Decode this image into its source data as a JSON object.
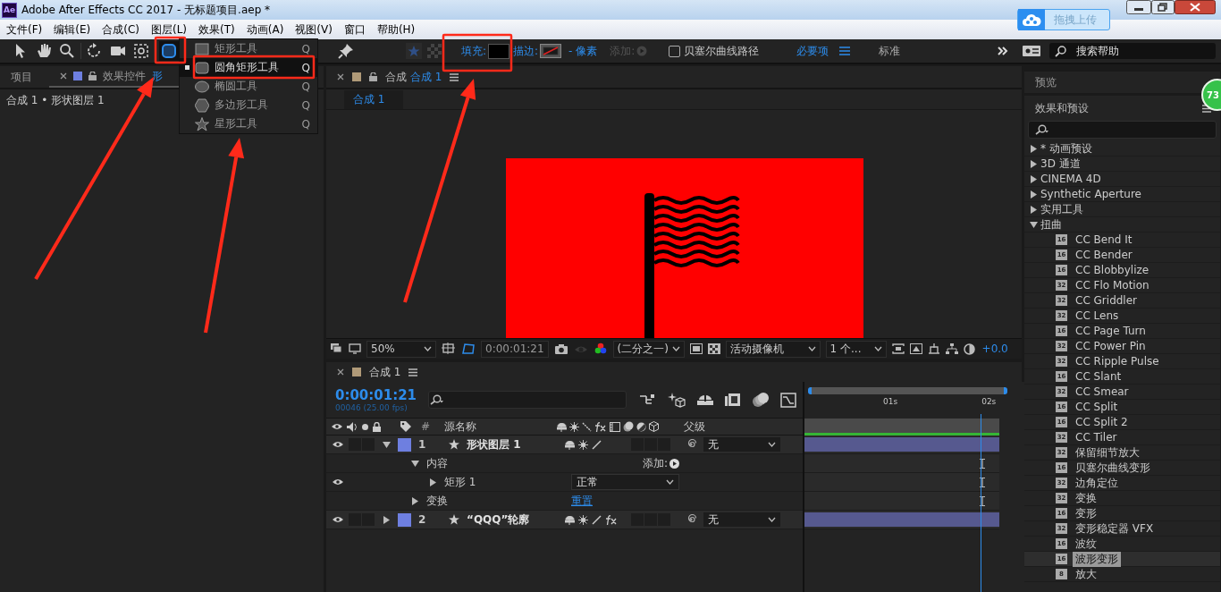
{
  "window": {
    "title": "Adobe After Effects CC 2017 - 无标题项目.aep *",
    "app_icon": "Ae"
  },
  "upload_button": {
    "label": "拖拽上传"
  },
  "badge": {
    "count": "73"
  },
  "menu": [
    "文件(F)",
    "编辑(E)",
    "合成(C)",
    "图层(L)",
    "效果(T)",
    "动画(A)",
    "视图(V)",
    "窗口",
    "帮助(H)"
  ],
  "toolbar": {
    "tools": [
      {
        "kind": "select",
        "selected": false
      },
      {
        "kind": "hand",
        "selected": false
      },
      {
        "kind": "zoom",
        "selected": false
      },
      {
        "kind": "rotate",
        "selected": false
      },
      {
        "kind": "camera",
        "selected": false
      },
      {
        "kind": "pan",
        "selected": false
      },
      {
        "kind": "shape",
        "selected": true
      },
      {
        "kind": "pin",
        "selected": false
      }
    ],
    "fill_label": "填充:",
    "stroke_label": "描边:",
    "stroke_width": "- 像素",
    "add_label": "添加:",
    "bezier": {
      "label": "贝塞尔曲线路径",
      "checked": false
    },
    "workspaces": [
      {
        "label": "必要项",
        "selected": true
      },
      {
        "label": "标准",
        "selected": false
      }
    ],
    "search": {
      "placeholder": "搜索帮助"
    }
  },
  "shape_menu": {
    "items": [
      {
        "kind": "rect",
        "label": "矩形工具",
        "shortcut": "Q",
        "selected": false
      },
      {
        "kind": "rounded",
        "label": "圆角矩形工具",
        "shortcut": "Q",
        "selected": true
      },
      {
        "kind": "ellipse",
        "label": "椭圆工具",
        "shortcut": "Q",
        "selected": false
      },
      {
        "kind": "polygon",
        "label": "多边形工具",
        "shortcut": "Q",
        "selected": false
      },
      {
        "kind": "star",
        "label": "星形工具",
        "shortcut": "Q",
        "selected": false
      }
    ]
  },
  "left_panel": {
    "tabs": [
      {
        "label": "项目",
        "selected": false
      },
      {
        "label": "效果控件",
        "target": "形",
        "selected": true
      }
    ],
    "breadcrumb": "合成 1 • 形状图层 1"
  },
  "viewer": {
    "tab": {
      "label": "合成",
      "target": "合成 1"
    },
    "breadcrumb": "合成 1",
    "zoom": "50%",
    "time": "0:00:01:21",
    "resolution": "(二分之一)",
    "camera": "活动摄像机",
    "views": "1 个...",
    "exposure": "+0.0"
  },
  "timeline": {
    "tab": "合成 1",
    "timecode": "0:00:01:21",
    "frame_info": "00046 (25.00 fps)",
    "columns": [
      "#",
      "源名称",
      "父级"
    ],
    "ruler": [
      "01s",
      "02s"
    ],
    "layers": [
      {
        "kind": "layer",
        "number": "1",
        "name": "形状图层 1",
        "expanded": true,
        "visible": true,
        "fx": false,
        "parent": "无",
        "children": [
          {
            "kind": "group",
            "name": "内容",
            "expanded": true,
            "action": "添加:",
            "children": [
              {
                "kind": "mode",
                "name": "矩形 1",
                "expanded": false,
                "visible": true,
                "mode": "正常"
              }
            ]
          },
          {
            "kind": "link",
            "name": "变换",
            "expanded": false,
            "link": "重置"
          }
        ]
      },
      {
        "kind": "layer",
        "number": "2",
        "name": "“QQQ”轮廓",
        "expanded": false,
        "visible": true,
        "fx": true,
        "parent": "无"
      }
    ]
  },
  "preview_panel": {
    "title": "预览"
  },
  "effects_panel": {
    "title": "效果和预设",
    "tree": [
      {
        "label": "* 动画预设",
        "expanded": false
      },
      {
        "label": "3D 通道",
        "expanded": false
      },
      {
        "label": "CINEMA 4D",
        "expanded": false
      },
      {
        "label": "Synthetic Aperture",
        "expanded": false
      },
      {
        "label": "实用工具",
        "expanded": false
      },
      {
        "label": "扭曲",
        "expanded": true,
        "children": [
          {
            "label": "CC Bend It",
            "bits": "16",
            "selected": false
          },
          {
            "label": "CC Bender",
            "bits": "16",
            "selected": false
          },
          {
            "label": "CC Blobbylize",
            "bits": "16",
            "selected": false
          },
          {
            "label": "CC Flo Motion",
            "bits": "32",
            "selected": false
          },
          {
            "label": "CC Griddler",
            "bits": "32",
            "selected": false
          },
          {
            "label": "CC Lens",
            "bits": "32",
            "selected": false
          },
          {
            "label": "CC Page Turn",
            "bits": "16",
            "selected": false
          },
          {
            "label": "CC Power Pin",
            "bits": "32",
            "selected": false
          },
          {
            "label": "CC Ripple Pulse",
            "bits": "32",
            "selected": false
          },
          {
            "label": "CC Slant",
            "bits": "16",
            "selected": false
          },
          {
            "label": "CC Smear",
            "bits": "32",
            "selected": false
          },
          {
            "label": "CC Split",
            "bits": "16",
            "selected": false
          },
          {
            "label": "CC Split 2",
            "bits": "16",
            "selected": false
          },
          {
            "label": "CC Tiler",
            "bits": "32",
            "selected": false
          },
          {
            "label": "保留细节放大",
            "bits": "32",
            "selected": false
          },
          {
            "label": "贝塞尔曲线变形",
            "bits": "16",
            "selected": false
          },
          {
            "label": "边角定位",
            "bits": "32",
            "selected": false
          },
          {
            "label": "变换",
            "bits": "32",
            "selected": false
          },
          {
            "label": "变形",
            "bits": "16",
            "selected": false
          },
          {
            "label": "变形稳定器 VFX",
            "bits": "32",
            "selected": false
          },
          {
            "label": "波纹",
            "bits": "16",
            "selected": false
          },
          {
            "label": "波形变形",
            "bits": "16",
            "selected": true
          },
          {
            "label": "放大",
            "bits": "8",
            "selected": false
          }
        ]
      }
    ]
  }
}
